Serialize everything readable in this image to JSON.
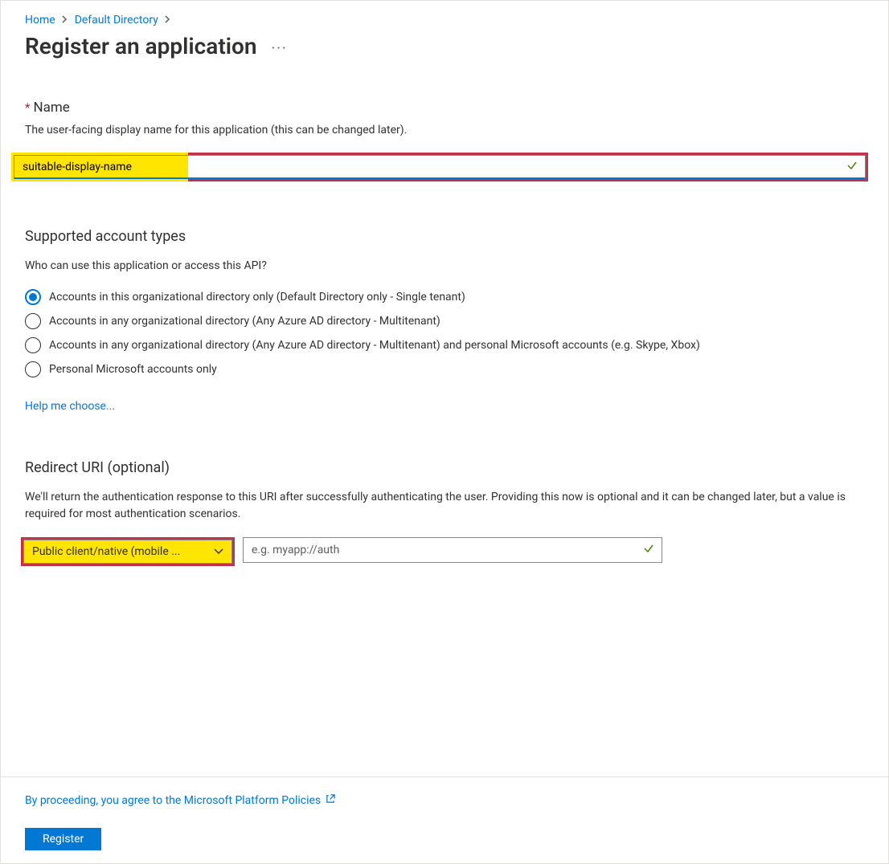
{
  "breadcrumb": {
    "items": [
      {
        "label": "Home"
      },
      {
        "label": "Default Directory"
      }
    ]
  },
  "page": {
    "title": "Register an application"
  },
  "name_section": {
    "label": "Name",
    "description": "The user-facing display name for this application (this can be changed later).",
    "value": "suitable-display-name"
  },
  "account_types": {
    "heading": "Supported account types",
    "question": "Who can use this application or access this API?",
    "options": [
      {
        "label": "Accounts in this organizational directory only (Default Directory only - Single tenant)",
        "selected": true
      },
      {
        "label": "Accounts in any organizational directory (Any Azure AD directory - Multitenant)",
        "selected": false
      },
      {
        "label": "Accounts in any organizational directory (Any Azure AD directory - Multitenant) and personal Microsoft accounts (e.g. Skype, Xbox)",
        "selected": false
      },
      {
        "label": "Personal Microsoft accounts only",
        "selected": false
      }
    ],
    "help_link": "Help me choose..."
  },
  "redirect_uri": {
    "heading": "Redirect URI (optional)",
    "description": "We'll return the authentication response to this URI after successfully authenticating the user. Providing this now is optional and it can be changed later, but a value is required for most authentication scenarios.",
    "platform_selected": "Public client/native (mobile ...",
    "uri_placeholder": "e.g. myapp://auth",
    "uri_value": ""
  },
  "footer": {
    "agree_text": "By proceeding, you agree to the Microsoft Platform Policies",
    "register_label": "Register"
  }
}
